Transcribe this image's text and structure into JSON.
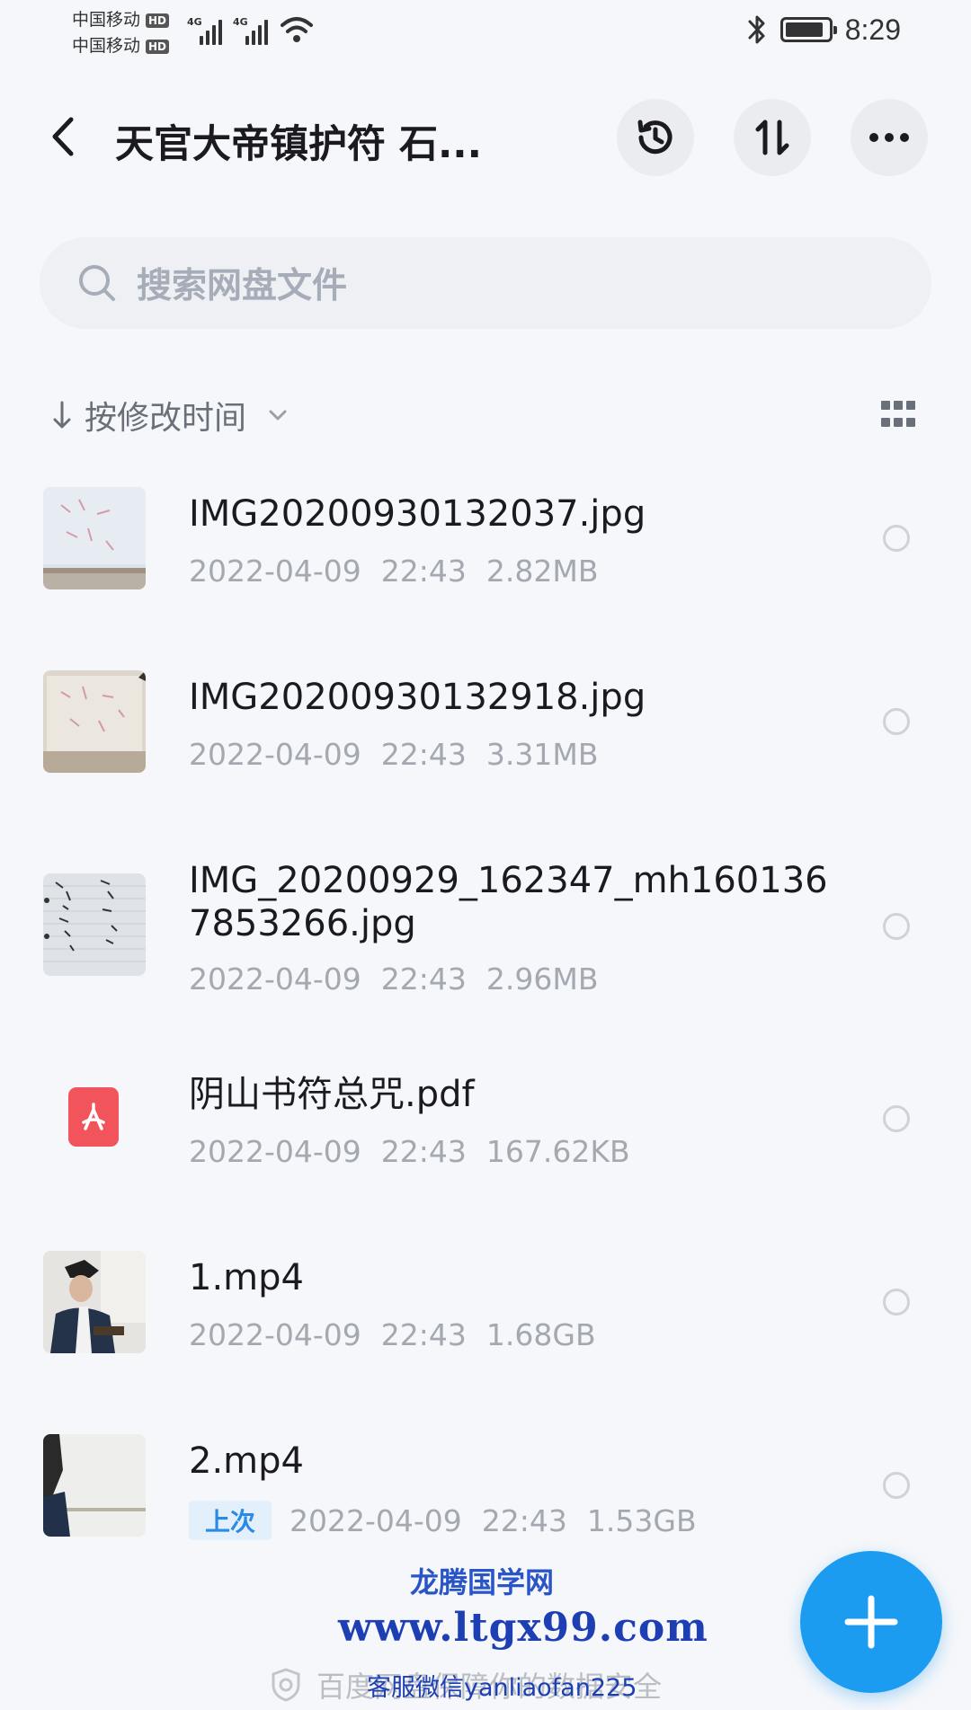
{
  "status_bar": {
    "carrier_1": "中国移动",
    "carrier_2": "中国移动",
    "hd_label": "HD",
    "network_1": "4G",
    "network_2": "4G",
    "time": "8:29",
    "battery_level": 0.9
  },
  "header": {
    "title": "天官大帝镇护符 石...",
    "back_icon": "chevron-left-icon",
    "history_icon": "history-icon",
    "transfer_icon": "transfer-icon",
    "more_icon": "more-icon"
  },
  "search": {
    "placeholder": "搜索网盘文件"
  },
  "sort": {
    "label": "按修改时间"
  },
  "files": [
    {
      "name": "IMG20200930132037.jpg",
      "date": "2022-04-09",
      "time": "22:43",
      "size": "2.82MB"
    },
    {
      "name": "IMG20200930132918.jpg",
      "date": "2022-04-09",
      "time": "22:43",
      "size": "3.31MB"
    },
    {
      "name": "IMG_20200929_162347_mh1601367853266.jpg",
      "date": "2022-04-09",
      "time": "22:43",
      "size": "2.96MB"
    },
    {
      "name": "阴山书符总咒.pdf",
      "date": "2022-04-09",
      "time": "22:43",
      "size": "167.62KB"
    },
    {
      "name": "1.mp4",
      "date": "2022-04-09",
      "time": "22:43",
      "size": "1.68GB"
    },
    {
      "name": "2.mp4",
      "badge": "上次",
      "date": "2022-04-09",
      "time": "22:43",
      "size": "1.53GB"
    }
  ],
  "watermark": {
    "title": "龙腾国学网",
    "url": "www.ltgx99.com",
    "service": "客服微信yanliaofan225"
  },
  "footer": {
    "text": "百度网盘保障你的数据安全"
  },
  "colors": {
    "accent": "#1c9cf0",
    "badge_bg": "#e3f0fb",
    "badge_text": "#2b8ae6",
    "pdf_red": "#f2545b",
    "watermark_blue": "#1d3fb3"
  }
}
